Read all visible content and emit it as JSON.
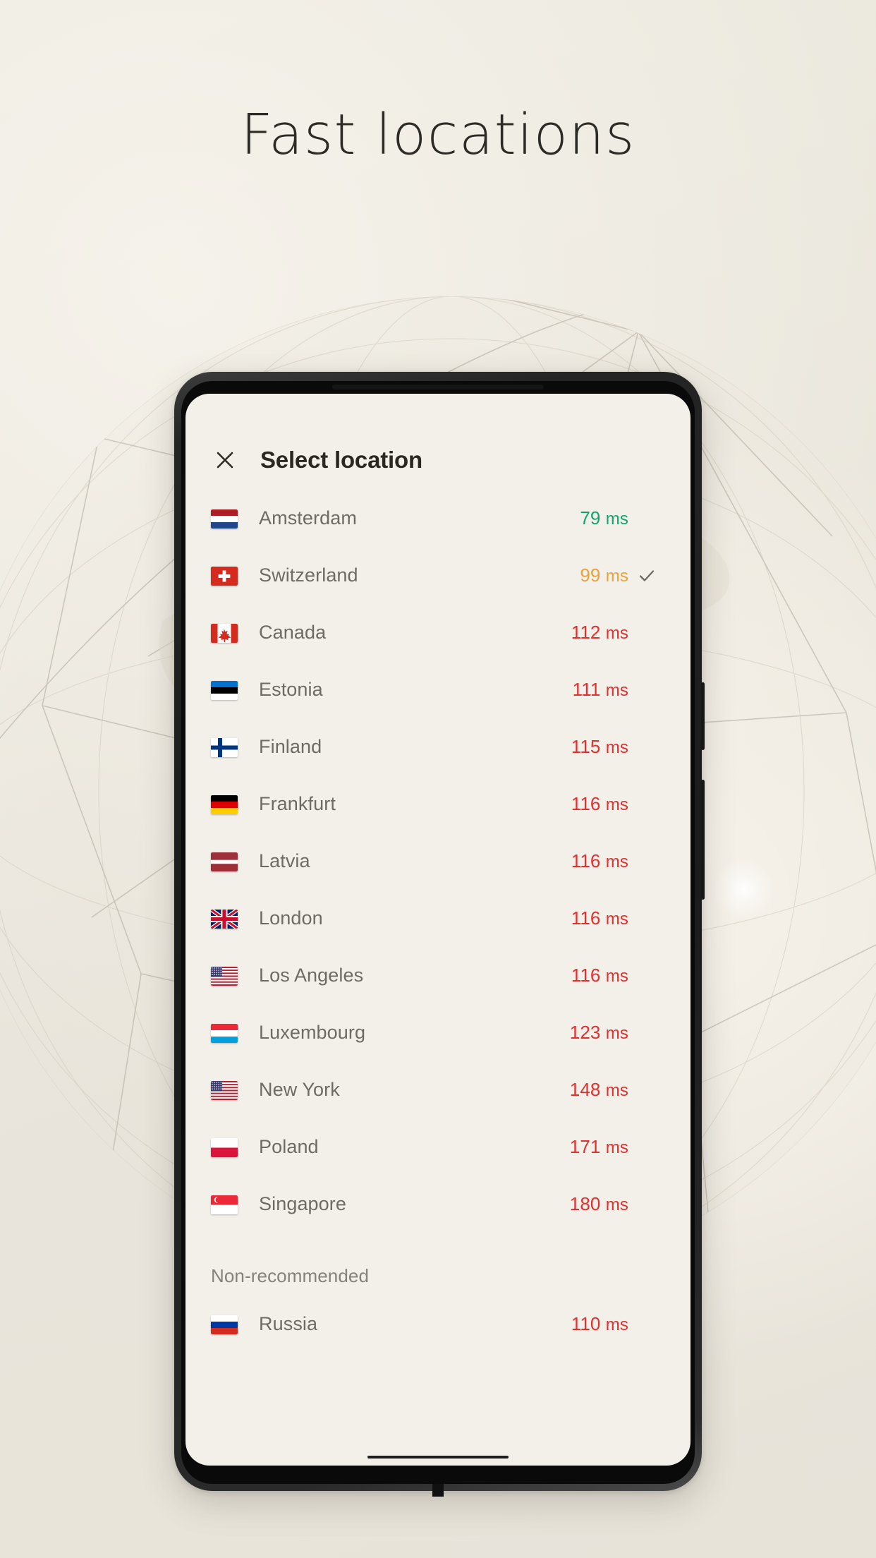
{
  "hero": {
    "title": "Fast locations"
  },
  "phone": {
    "app": {
      "header": {
        "close_icon": "close-icon",
        "title": "Select location"
      },
      "list": [
        {
          "flag": "netherlands-flag",
          "name": "Amsterdam",
          "ping": "79",
          "unit": "ms",
          "color": "#12a56a",
          "selected": false
        },
        {
          "flag": "switzerland-flag",
          "name": "Switzerland",
          "ping": "99",
          "unit": "ms",
          "color": "#e8a33d",
          "selected": true
        },
        {
          "flag": "canada-flag",
          "name": "Canada",
          "ping": "112",
          "unit": "ms",
          "color": "#e03131",
          "selected": false
        },
        {
          "flag": "estonia-flag",
          "name": "Estonia",
          "ping": "111",
          "unit": "ms",
          "color": "#e03131",
          "selected": false
        },
        {
          "flag": "finland-flag",
          "name": "Finland",
          "ping": "115",
          "unit": "ms",
          "color": "#e03131",
          "selected": false
        },
        {
          "flag": "germany-flag",
          "name": "Frankfurt",
          "ping": "116",
          "unit": "ms",
          "color": "#e03131",
          "selected": false
        },
        {
          "flag": "latvia-flag",
          "name": "Latvia",
          "ping": "116",
          "unit": "ms",
          "color": "#e03131",
          "selected": false
        },
        {
          "flag": "uk-flag",
          "name": "London",
          "ping": "116",
          "unit": "ms",
          "color": "#e03131",
          "selected": false
        },
        {
          "flag": "usa-flag",
          "name": "Los Angeles",
          "ping": "116",
          "unit": "ms",
          "color": "#e03131",
          "selected": false
        },
        {
          "flag": "luxembourg-flag",
          "name": "Luxembourg",
          "ping": "123",
          "unit": "ms",
          "color": "#e03131",
          "selected": false
        },
        {
          "flag": "usa-flag",
          "name": "New York",
          "ping": "148",
          "unit": "ms",
          "color": "#e03131",
          "selected": false
        },
        {
          "flag": "poland-flag",
          "name": "Poland",
          "ping": "171",
          "unit": "ms",
          "color": "#e03131",
          "selected": false
        },
        {
          "flag": "singapore-flag",
          "name": "Singapore",
          "ping": "180",
          "unit": "ms",
          "color": "#e03131",
          "selected": false
        }
      ],
      "section_non_recommended": {
        "label": "Non-recommended",
        "items": [
          {
            "flag": "russia-flag",
            "name": "Russia",
            "ping": "110",
            "unit": "ms",
            "color": "#e03131",
            "selected": false
          }
        ]
      }
    }
  },
  "colors": {
    "page_bg": "#e9e6de",
    "screen_bg": "#f3f0e9",
    "title_text": "#2d2b26",
    "header_text": "#2b2824",
    "row_text": "#6e6b66",
    "section_text": "#85827c",
    "ping_good": "#12a56a",
    "ping_warn": "#e8a33d",
    "ping_bad": "#e03131",
    "check": "#6e6b66",
    "device": "#1b1b1b"
  }
}
